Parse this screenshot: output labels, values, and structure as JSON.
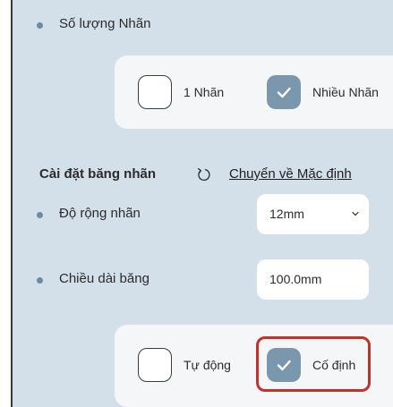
{
  "label_count": {
    "label": "Số lượng Nhãn",
    "options": [
      {
        "label": "1 Nhãn",
        "checked": false
      },
      {
        "label": "Nhiều Nhãn",
        "checked": true
      }
    ]
  },
  "tape_settings": {
    "title": "Cài đặt băng nhãn",
    "reset_link": "Chuyển về Mặc định",
    "label_width": {
      "label": "Độ rộng nhãn",
      "value": "12mm"
    },
    "tape_length": {
      "label": "Chiều dài băng",
      "value": "100.0mm"
    },
    "mode_options": [
      {
        "label": "Tự động",
        "checked": false
      },
      {
        "label": "Cố định",
        "checked": true
      }
    ]
  },
  "colors": {
    "panel_bg": "#d3dfe9",
    "card_bg": "#f4f6f8",
    "checked_bg": "#7b97ad",
    "highlight": "#c6302a"
  },
  "icons": [
    "bullet-icon",
    "check-icon",
    "reset-icon",
    "chevron-down-icon"
  ]
}
